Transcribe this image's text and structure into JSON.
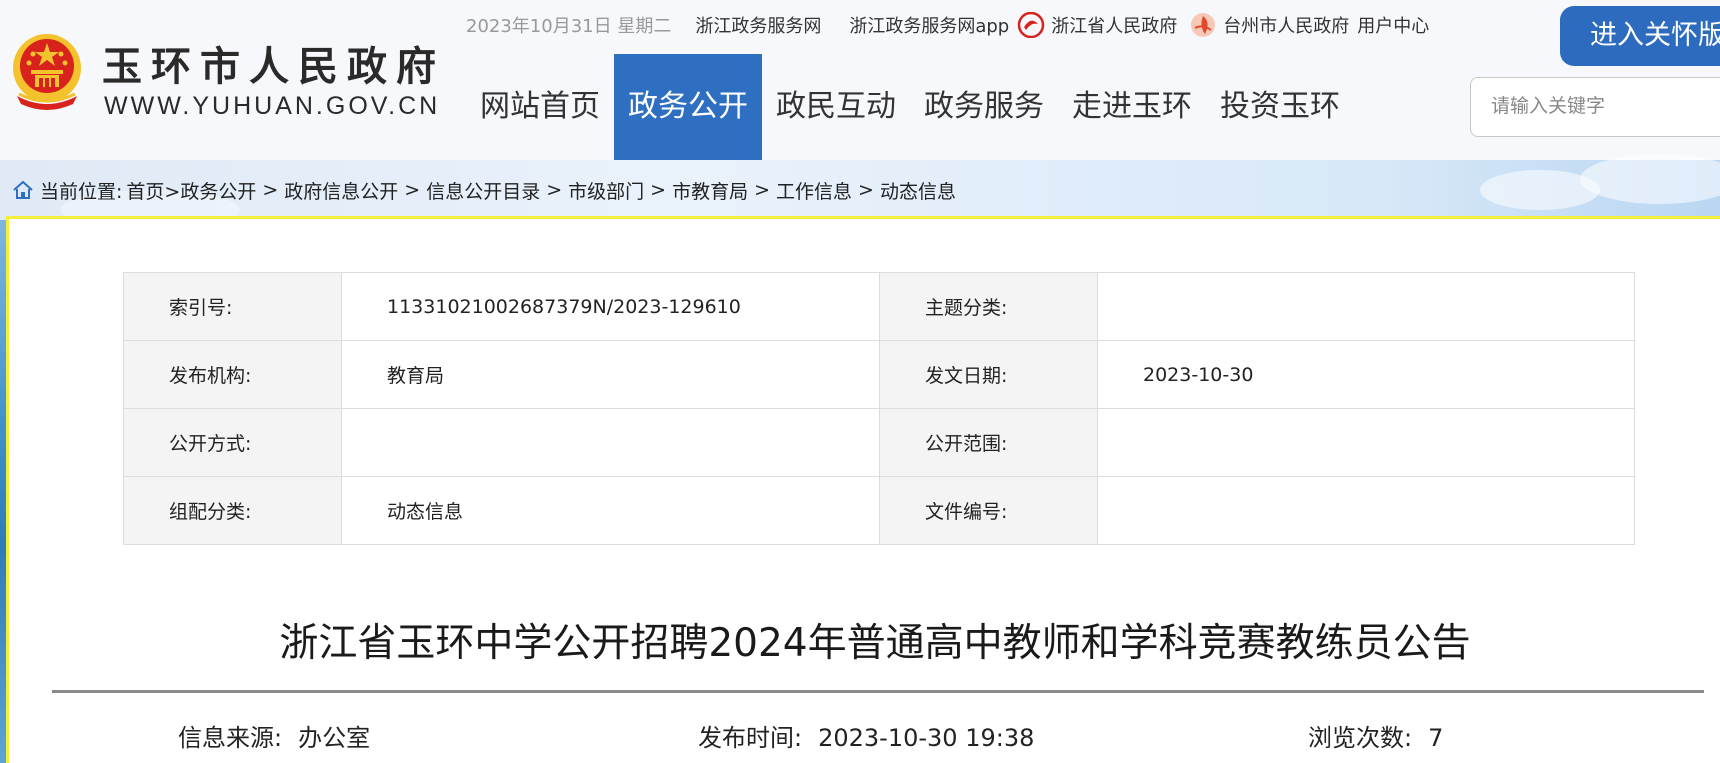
{
  "header": {
    "site_name": "玉环市人民政府",
    "site_domain": "WWW.YUHUAN.GOV.CN",
    "date": "2023年10月31日 星期二",
    "top_links": {
      "zj_service": "浙江政务服务网",
      "zj_service_app": "浙江政务服务网app",
      "zj_gov": "浙江省人民政府",
      "tz_gov": "台州市人民政府",
      "user_center": "用户中心"
    },
    "care_mode_label": "进入关怀版",
    "search_placeholder": "请输入关键字"
  },
  "nav": {
    "items": [
      "网站首页",
      "政务公开",
      "政民互动",
      "政务服务",
      "走进玉环",
      "投资玉环"
    ],
    "active": "政务公开"
  },
  "breadcrumb": {
    "label": "当前位置:",
    "items": [
      "首页>",
      "政务公开",
      "政府信息公开",
      "信息公开目录",
      "市级部门",
      "市教育局",
      "工作信息",
      "动态信息"
    ],
    "separator": ">"
  },
  "meta": {
    "index_no_label": "索引号:",
    "index_no": "11331021002687379N/2023-129610",
    "topic_label": "主题分类:",
    "topic": "",
    "publisher_label": "发布机构:",
    "publisher": "教育局",
    "issue_date_label": "发文日期:",
    "issue_date": "2023-10-30",
    "open_method_label": "公开方式:",
    "open_method": "",
    "open_scope_label": "公开范围:",
    "open_scope": "",
    "category_label": "组配分类:",
    "category": "动态信息",
    "doc_no_label": "文件编号:",
    "doc_no": ""
  },
  "article": {
    "title": "浙江省玉环中学公开招聘2024年普通高中教师和学科竞赛教练员公告",
    "source_label": "信息来源:",
    "source": "办公室",
    "time_label": "发布时间:",
    "time": "2023-10-30 19:38",
    "views_label": "浏览次数:",
    "views": "7"
  },
  "colors": {
    "nav_active_bg": "#2f6fc2",
    "care_button_bg": "#2c6bbd",
    "emblem_red": "#d8231d",
    "emblem_gold": "#f4c22c",
    "panel_border": "#f2ee3a"
  },
  "icons": {
    "emblem": "national-emblem-icon",
    "zj_gov": "zhejiang-gov-logo-icon",
    "tz_gov": "taizhou-gov-logo-icon",
    "home": "home-icon"
  }
}
